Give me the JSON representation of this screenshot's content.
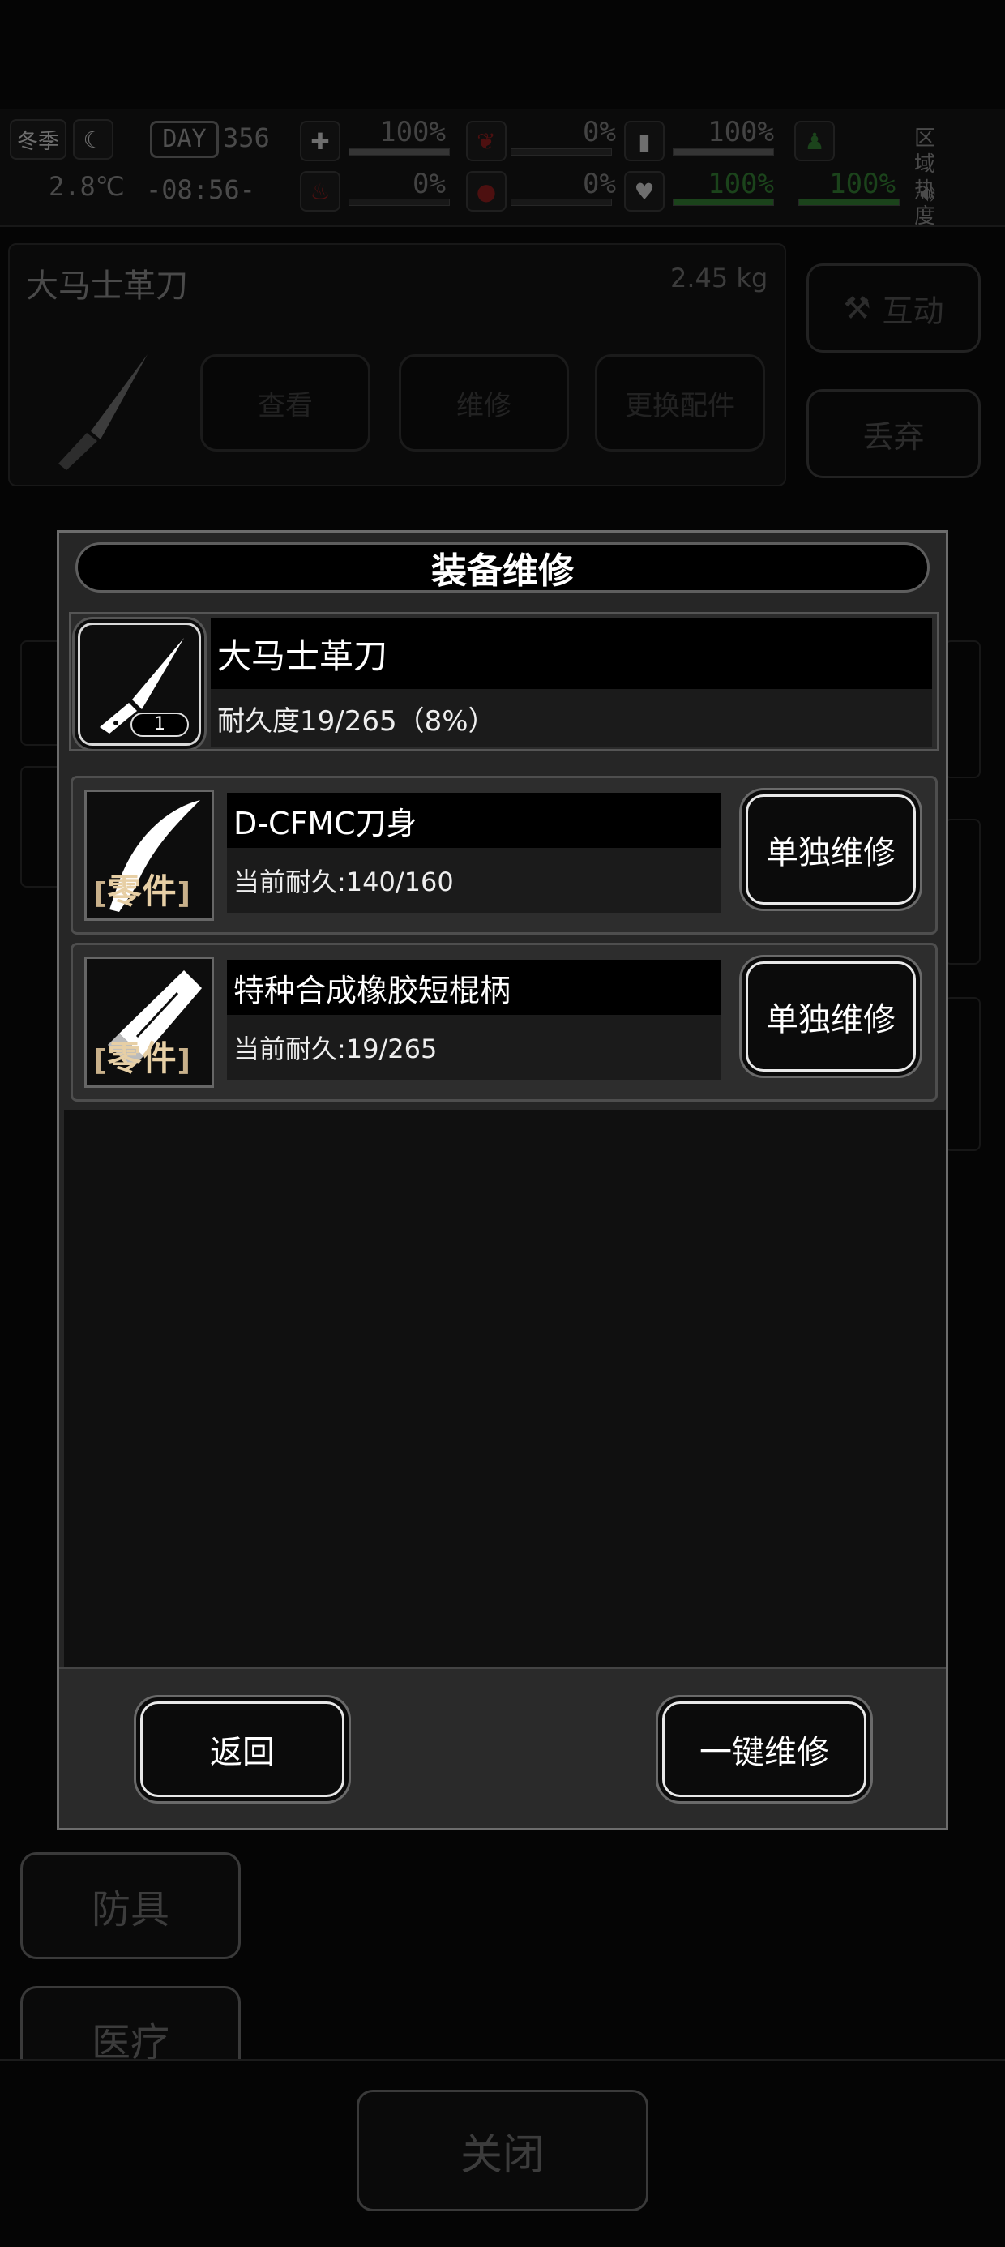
{
  "hud": {
    "season": "冬季",
    "day_label": "DAY",
    "day_number": "356",
    "temperature": "2.8℃",
    "clock": "-08:56-",
    "stats_row1": [
      "100%",
      "0%",
      "100%"
    ],
    "stats_row2": [
      "0%",
      "0%",
      "100%",
      "100%"
    ],
    "region_heat_label": "区域热度"
  },
  "background": {
    "item_name": "大马士革刀",
    "item_weight": "2.45 kg",
    "view_button": "查看",
    "repair_button": "维修",
    "swap_parts_button": "更换配件",
    "interact_button": "互动",
    "discard_button": "丢弃",
    "armor_tab": "防具",
    "medical_tab": "医疗",
    "close_button": "关闭"
  },
  "modal": {
    "title": "装备维修",
    "item": {
      "name": "大马士革刀",
      "durability": "耐久度19/265（8%）",
      "quantity": "1"
    },
    "part_tag": "零件",
    "parts": [
      {
        "name": "D-CFMC刀身",
        "durability": "当前耐久:140/160",
        "button": "单独维修"
      },
      {
        "name": "特种合成橡胶短棍柄",
        "durability": "当前耐久:19/265",
        "button": "单独维修"
      }
    ],
    "back_button": "返回",
    "repair_all_button": "一键维修"
  },
  "colors": {
    "panel_bg": "#262626",
    "button_border": "#e8e8e8",
    "part_tag": "#e7cfa5",
    "health_green": "#3a9a3a",
    "danger_red": "#b02020"
  }
}
